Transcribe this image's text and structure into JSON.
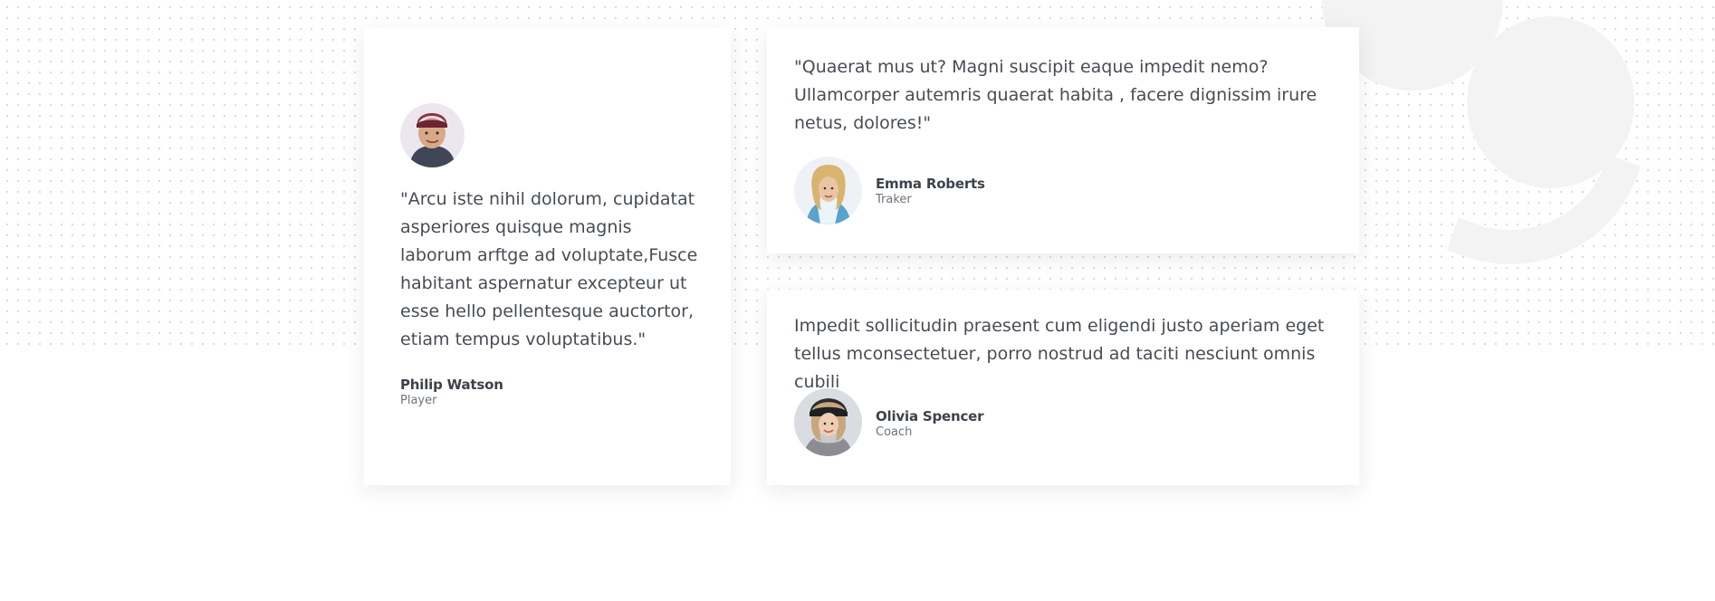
{
  "testimonials": {
    "featured": {
      "quote": "\"Arcu iste nihil dolorum, cupidatat asperiores quisque magnis laborum arftge ad voluptate,Fusce habitant aspernatur excepteur ut esse hello pellentesque auctortor, etiam tempus voluptatibus.\"",
      "name": "Philip Watson",
      "role": "Player",
      "avatar_alt": "Philip Watson"
    },
    "top": {
      "quote": "\"Quaerat mus ut? Magni suscipit eaque impedit nemo? Ullamcorper autemris quaerat habita , facere dignissim irure netus, dolores!\"",
      "name": "Emma Roberts",
      "role": "Traker",
      "avatar_alt": "Emma Roberts"
    },
    "bottom": {
      "quote": "Impedit sollicitudin praesent cum eligendi justo aperiam eget tellus mconsectetuer, porro nostrud ad taciti nesciunt omnis cubili",
      "name": "Olivia Spencer",
      "role": "Coach",
      "avatar_alt": "Olivia Spencer"
    }
  },
  "colors": {
    "page_background": "#ffffff",
    "card_background": "#ffffff",
    "text": "#474c55",
    "name": "#3d424a",
    "role": "#6d727a",
    "dot_pattern": "#d9dbe0",
    "quote_watermark": "#f3f3f4"
  },
  "icons": {
    "background": "dot-pattern",
    "watermark": "quote-mark-icon"
  }
}
